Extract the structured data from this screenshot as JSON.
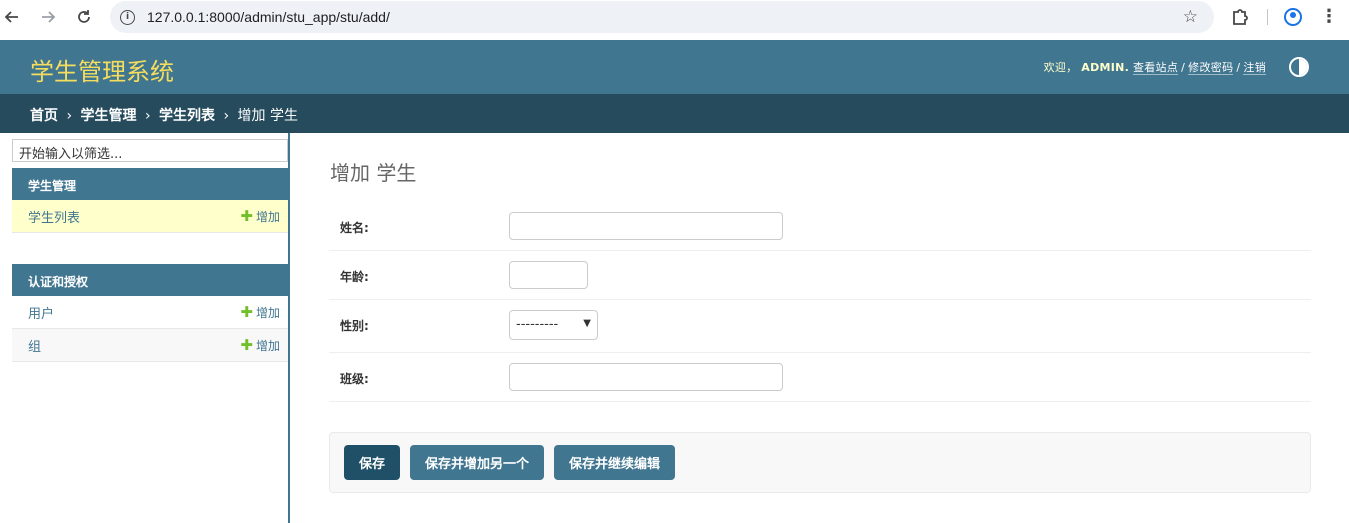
{
  "browser": {
    "url": "127.0.0.1:8000/admin/stu_app/stu/add/"
  },
  "header": {
    "brand": "学生管理系统",
    "welcome": "欢迎，",
    "username": "ADMIN.",
    "view_site": "查看站点",
    "change_password": "修改密码",
    "logout": "注销",
    "slash": "/"
  },
  "breadcrumbs": {
    "home": "首页",
    "app": "学生管理",
    "model": "学生列表",
    "current": "增加 学生",
    "separator": "›"
  },
  "sidebar": {
    "filter_placeholder": "开始输入以筛选...",
    "modules": [
      {
        "caption": "学生管理",
        "rows": [
          {
            "label": "学生列表",
            "add": "增加"
          }
        ]
      },
      {
        "caption": "认证和授权",
        "rows": [
          {
            "label": "用户",
            "add": "增加"
          },
          {
            "label": "组",
            "add": "增加"
          }
        ]
      }
    ],
    "plus_glyph": "✚"
  },
  "form": {
    "title": "增加 学生",
    "fields": [
      {
        "label": "姓名:",
        "value": ""
      },
      {
        "label": "年龄:",
        "value": ""
      },
      {
        "label": "性别:",
        "value": "---------"
      },
      {
        "label": "班级:",
        "value": ""
      }
    ],
    "buttons": {
      "save": "保存",
      "save_add_another": "保存并增加另一个",
      "save_continue": "保存并继续编辑"
    }
  },
  "colors": {
    "header_bg": "#417690",
    "breadcrumb_bg": "#264b5d",
    "brand_yellow": "#f5dd5d",
    "primary_button": "#205067",
    "secondary_button": "#417690",
    "current_row_bg": "#ffffcc",
    "add_plus": "#70bf2b"
  }
}
